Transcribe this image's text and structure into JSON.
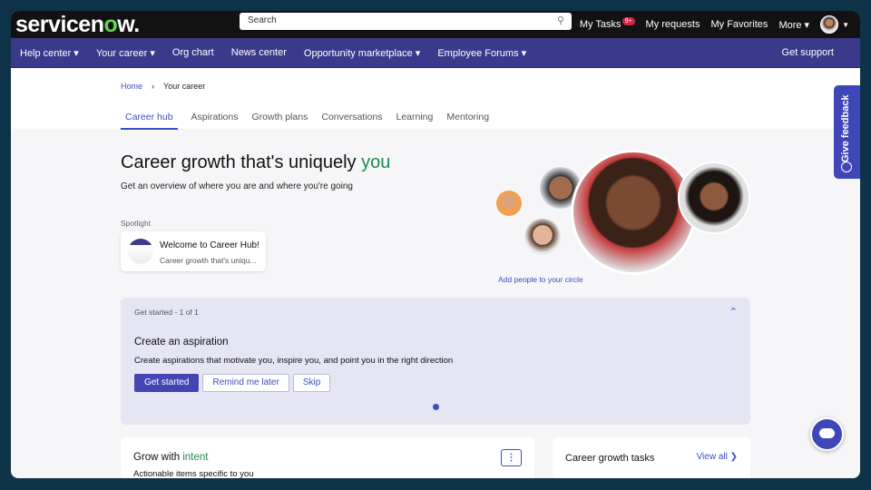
{
  "header": {
    "logo": "servicenow",
    "search_placeholder": "Search",
    "my_tasks": "My Tasks",
    "tasks_badge": "9+",
    "my_requests": "My requests",
    "my_favorites": "My Favorites",
    "more": "More ▾"
  },
  "nav": {
    "items": [
      "Help center ▾",
      "Your career ▾",
      "Org chart",
      "News center",
      "Opportunity marketplace ▾",
      "Employee Forums ▾"
    ],
    "get_support": "Get support"
  },
  "breadcrumb": {
    "home": "Home",
    "sep": "›",
    "current": "Your career"
  },
  "tabs": [
    "Career hub",
    "Aspirations",
    "Growth plans",
    "Conversations",
    "Learning",
    "Mentoring"
  ],
  "hero": {
    "title_a": "Career growth that's uniquely ",
    "title_b": "you",
    "subtitle": "Get an overview of where you are and where you're going",
    "add_people": "Add people to your circle"
  },
  "spotlight": {
    "label": "Spotlight",
    "title": "Welcome to Career Hub!",
    "text": "Career growth that's uniqu..."
  },
  "get_started": {
    "header": "Get started - 1 of 1",
    "title": "Create an aspiration",
    "description": "Create aspirations that motivate you, inspire you, and point you in the right direction",
    "buttons": [
      "Get started",
      "Remind me later",
      "Skip"
    ]
  },
  "grow": {
    "title_a": "Grow with ",
    "title_b": "intent",
    "subtitle": "Actionable items specific to you",
    "menu": "⋮"
  },
  "tasks": {
    "title": "Career growth tasks",
    "view_all": "View all ❯"
  },
  "feedback": {
    "label": "Give feedback"
  }
}
